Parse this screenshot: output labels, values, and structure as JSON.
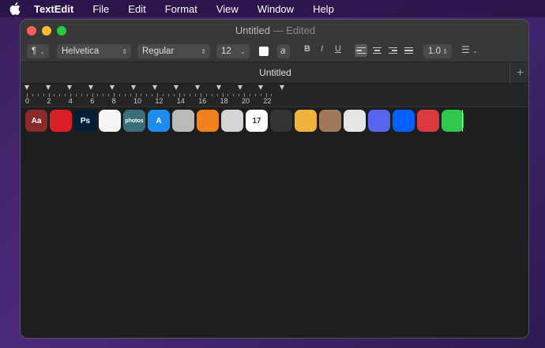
{
  "menubar": {
    "app_name": "TextEdit",
    "items": [
      "File",
      "Edit",
      "Format",
      "View",
      "Window",
      "Help"
    ]
  },
  "window": {
    "title": "Untitled",
    "title_sep": "—",
    "edited": "Edited",
    "tab_label": "Untitled",
    "tab_add": "+"
  },
  "toolbar": {
    "paragraph_label": "¶",
    "font_family": "Helvetica",
    "font_style": "Regular",
    "font_size": "12",
    "highlight_label": "a",
    "bold": "B",
    "italic": "I",
    "underline": "U",
    "line_spacing": "1.0"
  },
  "ruler": {
    "numbers": [
      "0",
      "2",
      "4",
      "6",
      "8",
      "10",
      "12",
      "14",
      "16",
      "18",
      "20",
      "22"
    ]
  },
  "document": {
    "icons": [
      {
        "name": "dictionary-icon",
        "label": "Aa",
        "color": "#8a2a2a"
      },
      {
        "name": "creative-cloud-icon",
        "label": "",
        "color": "#da1f26"
      },
      {
        "name": "photoshop-icon",
        "label": "Ps",
        "color": "#001e36"
      },
      {
        "name": "airtable-icon",
        "label": "",
        "color": "#f5f5f5"
      },
      {
        "name": "google-photos-icon",
        "label": "photos",
        "color": "#3b6e7a"
      },
      {
        "name": "app-store-icon",
        "label": "A",
        "color": "#1c8cf0"
      },
      {
        "name": "system-utility-icon",
        "label": "",
        "color": "#bbbbbb"
      },
      {
        "name": "books-icon",
        "label": "",
        "color": "#f0821e"
      },
      {
        "name": "calculator-icon",
        "label": "",
        "color": "#d5d5d5"
      },
      {
        "name": "calendar-icon",
        "label": "17",
        "color": "#ffffff"
      },
      {
        "name": "chess-icon",
        "label": "",
        "color": "#333333"
      },
      {
        "name": "photo-booth-icon",
        "label": "",
        "color": "#f2b33d"
      },
      {
        "name": "contacts-icon",
        "label": "",
        "color": "#a0785a"
      },
      {
        "name": "camera-icon",
        "label": "",
        "color": "#e5e5e5"
      },
      {
        "name": "discord-icon",
        "label": "",
        "color": "#5865f2"
      },
      {
        "name": "dropbox-icon",
        "label": "",
        "color": "#0061fe"
      },
      {
        "name": "expressvpn-icon",
        "label": "",
        "color": "#da3940"
      },
      {
        "name": "facetime-icon",
        "label": "",
        "color": "#2dc84d"
      }
    ]
  },
  "colors": {
    "desktop": "#3a1f5e",
    "window_bg": "#1e1e1e",
    "accent_arrow": "#ff0000"
  }
}
